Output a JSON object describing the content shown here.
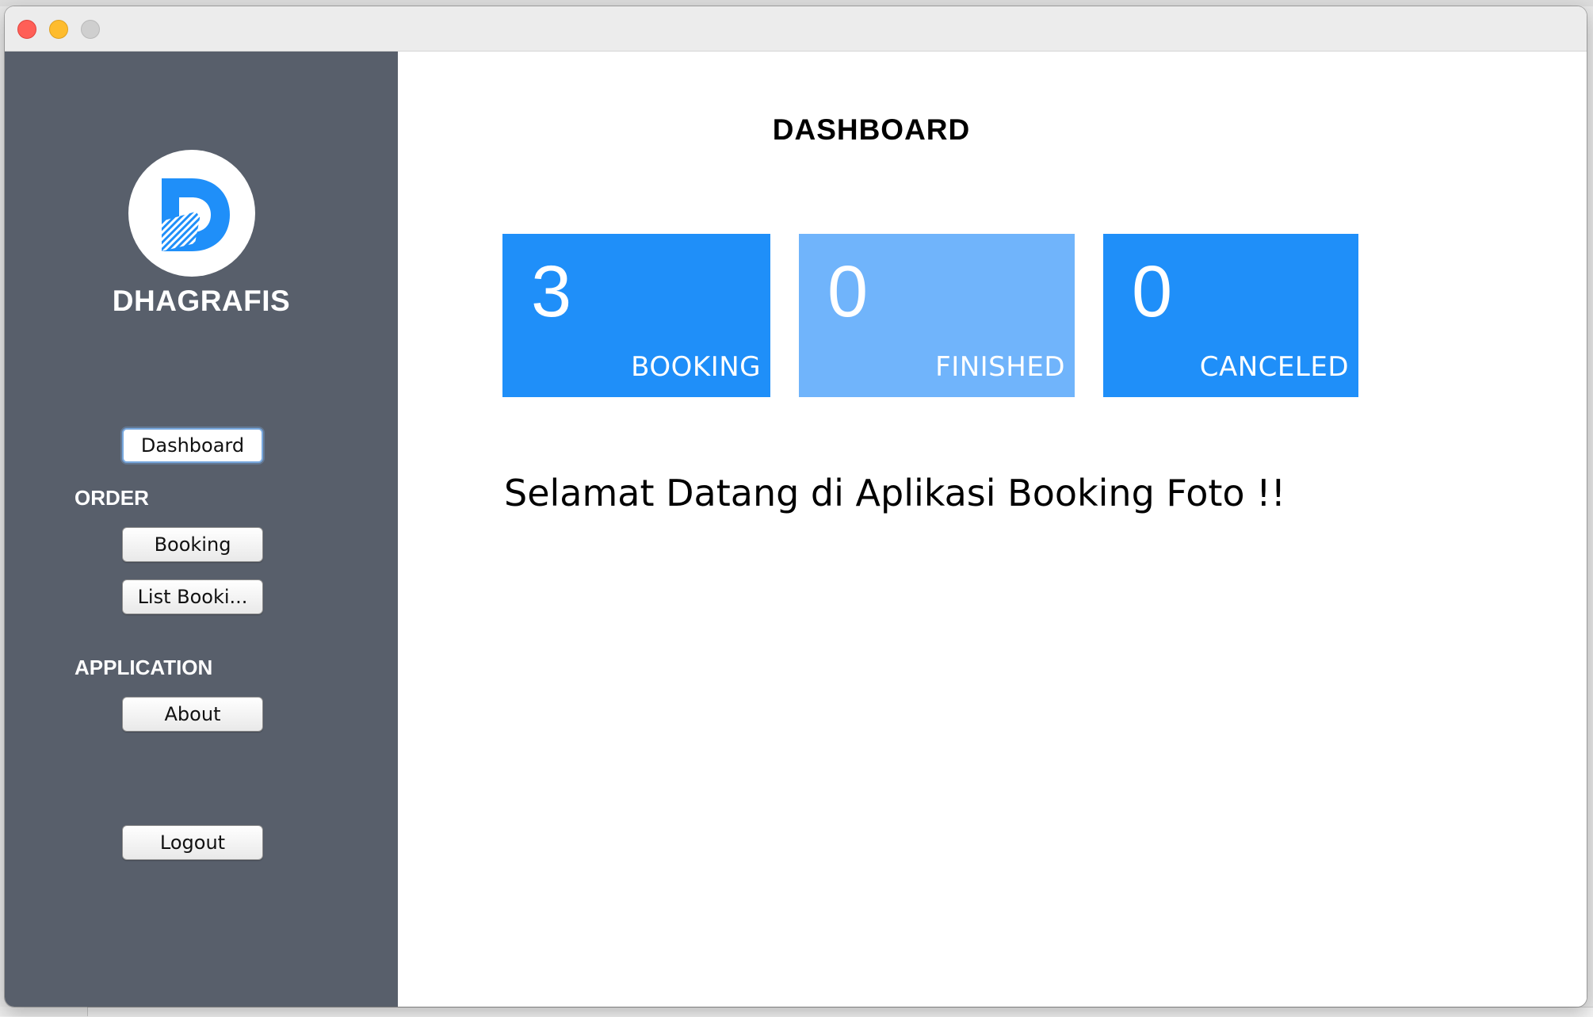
{
  "app": {
    "brand_name": "DHAGRAFIS",
    "logo_icon": "dhagrafis-d-logo-icon",
    "colors": {
      "sidebar": "#585f6b",
      "card_primary": "#1f8ff9",
      "card_secondary": "#70b4fb"
    }
  },
  "window": {
    "controls": [
      "close",
      "minimize",
      "maximize"
    ]
  },
  "sidebar": {
    "dashboard_button": "Dashboard",
    "order_section": {
      "label": "ORDER",
      "items": [
        "Booking",
        "List Booki..."
      ]
    },
    "application_section": {
      "label": "APPLICATION",
      "items": [
        "About"
      ]
    },
    "logout_button": "Logout"
  },
  "main": {
    "title": "DASHBOARD",
    "stats": [
      {
        "value": "3",
        "label": "BOOKING"
      },
      {
        "value": "0",
        "label": "FINISHED"
      },
      {
        "value": "0",
        "label": "CANCELED"
      }
    ],
    "welcome_text": "Selamat Datang di Aplikasi Booking Foto !!"
  }
}
